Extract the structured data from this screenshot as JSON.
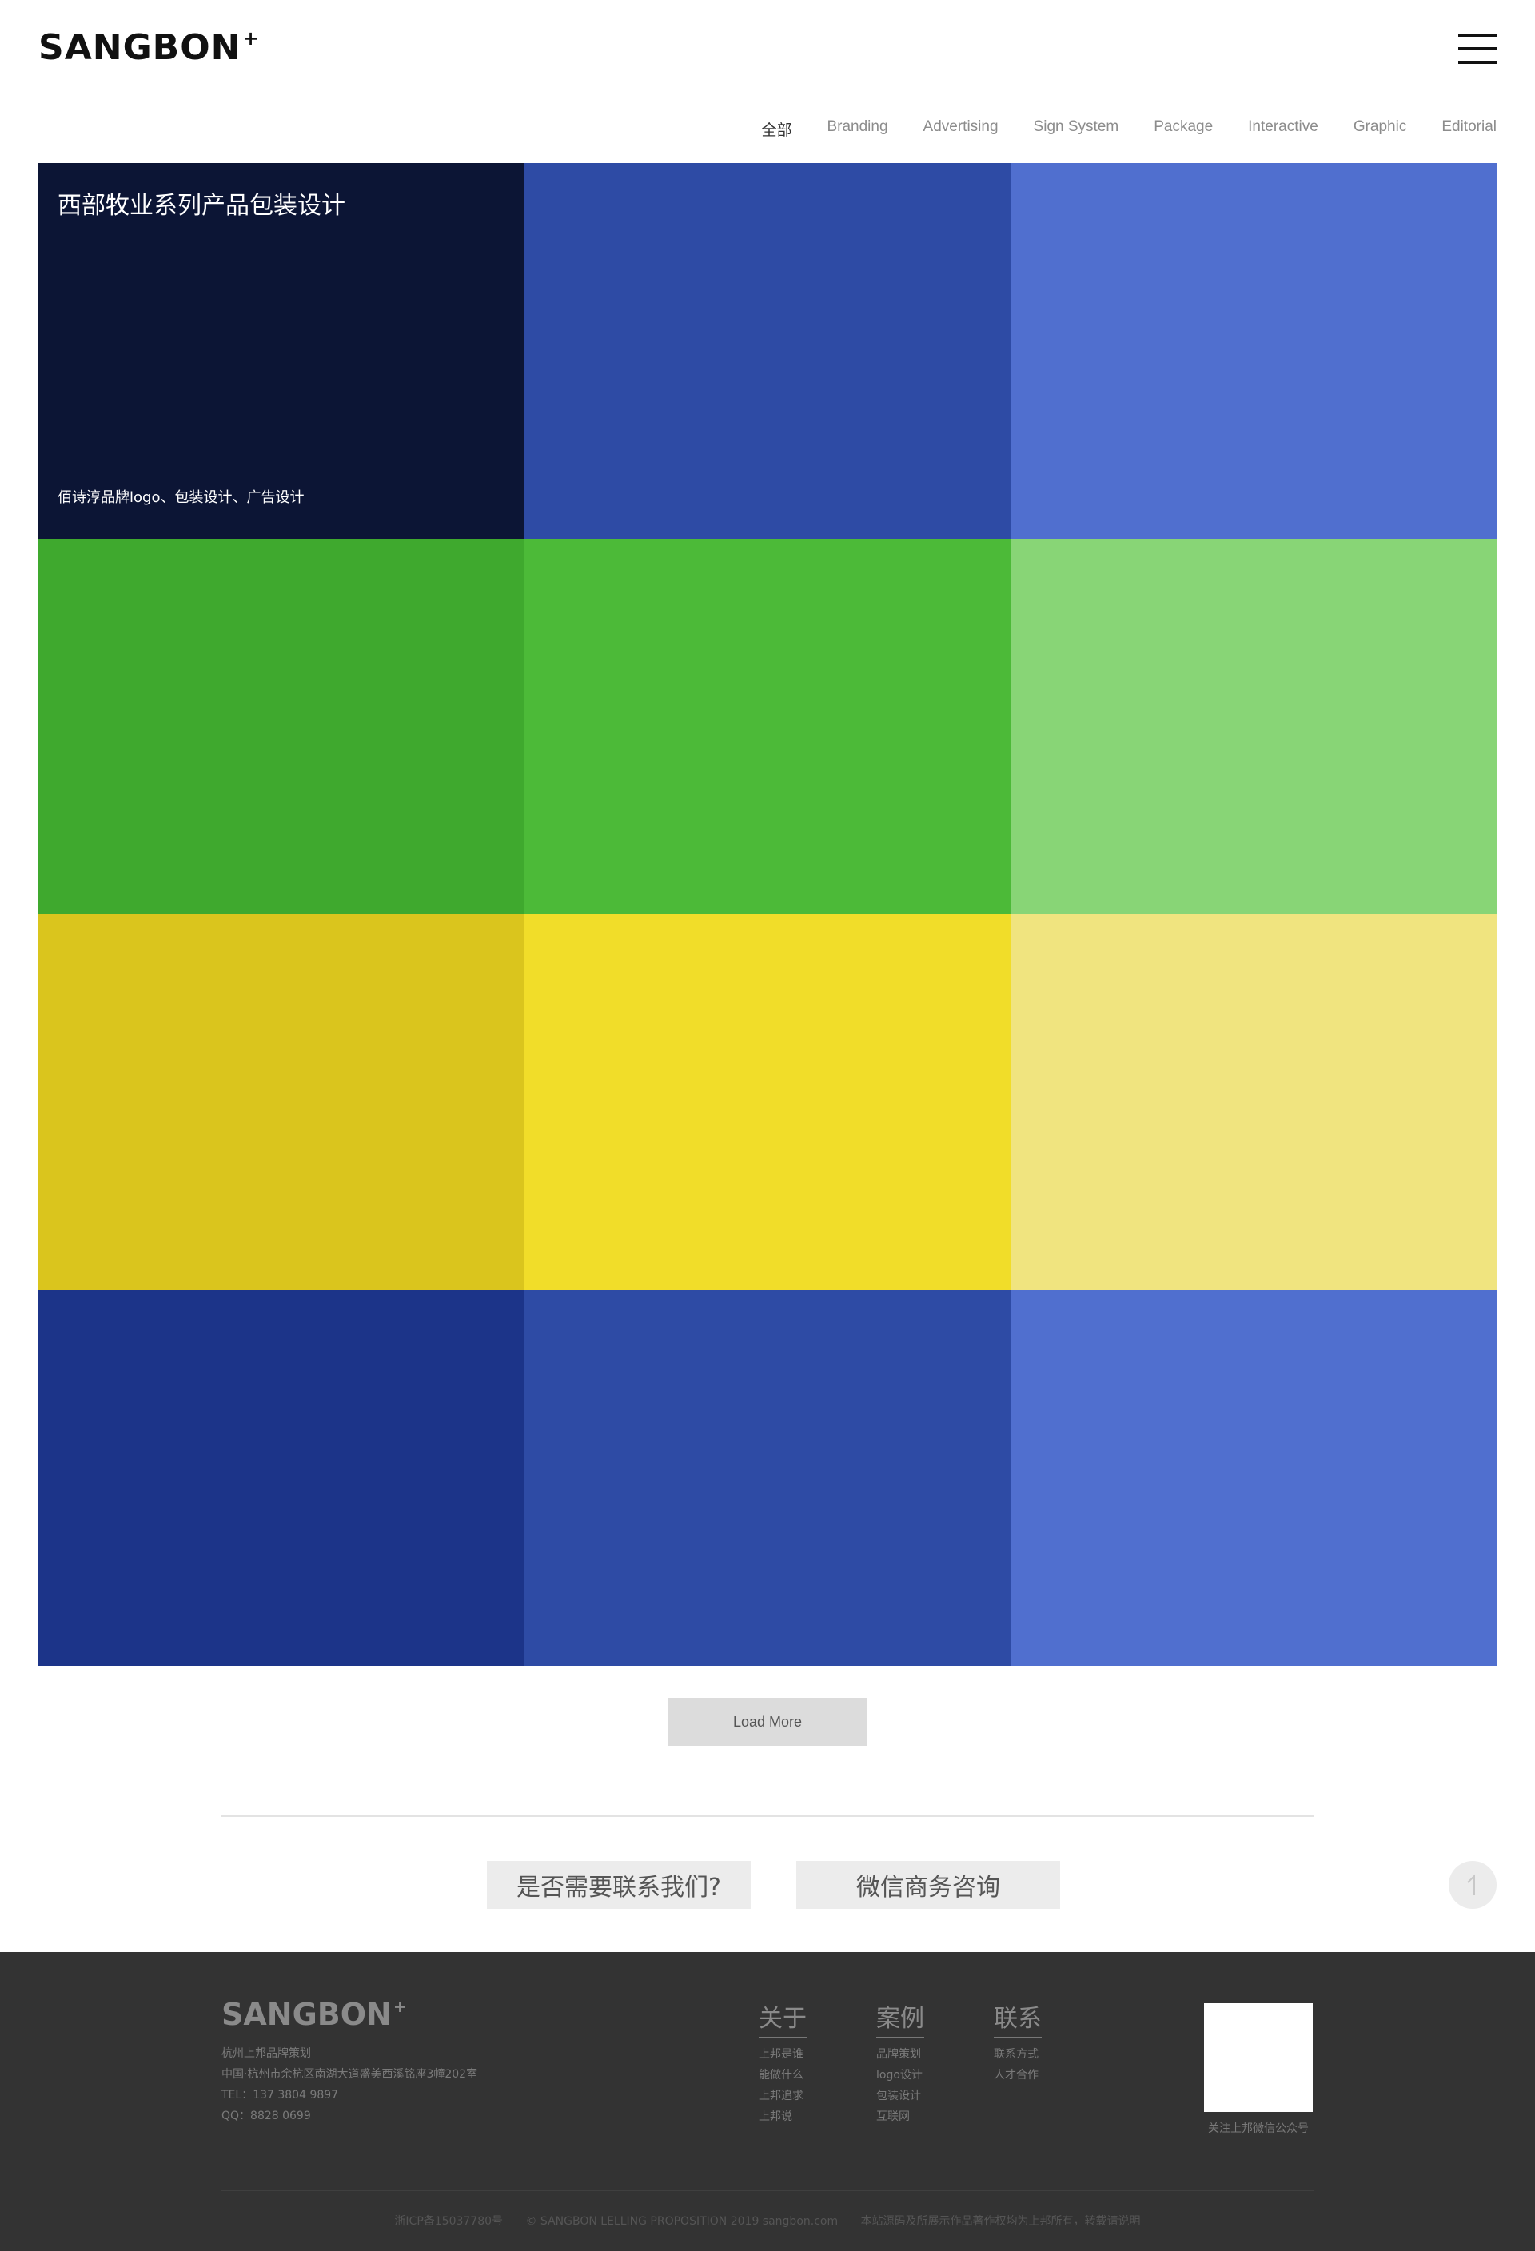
{
  "header": {
    "logo": "SANGBON",
    "logo_mark": "+",
    "menu_icon": "hamburger-menu-icon"
  },
  "filters": [
    {
      "label": "全部",
      "active": true
    },
    {
      "label": "Branding",
      "active": false
    },
    {
      "label": "Advertising",
      "active": false
    },
    {
      "label": "Sign System",
      "active": false
    },
    {
      "label": "Package",
      "active": false
    },
    {
      "label": "Interactive",
      "active": false
    },
    {
      "label": "Graphic",
      "active": false
    },
    {
      "label": "Editorial",
      "active": false
    }
  ],
  "tiles": [
    {
      "color": "#0c1535",
      "title": "西部牧业系列产品包装设计",
      "subtitle": "佰诗淳品牌logo、包装设计、广告设计"
    },
    {
      "color": "#2e4ba5",
      "title": "",
      "subtitle": ""
    },
    {
      "color": "#506fcf",
      "title": "",
      "subtitle": ""
    },
    {
      "color": "#3fa92e",
      "title": "",
      "subtitle": ""
    },
    {
      "color": "#4cba38",
      "title": "",
      "subtitle": ""
    },
    {
      "color": "#88d576",
      "title": "",
      "subtitle": ""
    },
    {
      "color": "#dac51d",
      "title": "",
      "subtitle": ""
    },
    {
      "color": "#f1dd29",
      "title": "",
      "subtitle": ""
    },
    {
      "color": "#f0e47f",
      "title": "",
      "subtitle": ""
    },
    {
      "color": "#1c3489",
      "title": "",
      "subtitle": ""
    },
    {
      "color": "#2e4ba5",
      "title": "",
      "subtitle": ""
    },
    {
      "color": "#506fcf",
      "title": "",
      "subtitle": ""
    }
  ],
  "load_more": "Load More",
  "cta": {
    "contact": "是否需要联系我们?",
    "wechat": "微信商务咨询",
    "back_top_icon": "arrow-up-icon"
  },
  "footer": {
    "logo": "SANGBON",
    "logo_mark": "+",
    "info": [
      "杭州上邦品牌策划",
      "中国·杭州市余杭区南湖大道盛美西溪铭座3幢202室",
      "TEL：137 3804 9897",
      "QQ：8828 0699"
    ],
    "columns": [
      {
        "title": "关于",
        "items": [
          "上邦是谁",
          "能做什么",
          "上邦追求",
          "上邦说"
        ]
      },
      {
        "title": "案例",
        "items": [
          "品牌策划",
          "logo设计",
          "包装设计",
          "互联网"
        ]
      },
      {
        "title": "联系",
        "items": [
          "联系方式",
          "人才合作"
        ]
      }
    ],
    "qr_caption": "关注上邦微信公众号",
    "bottom": [
      "浙ICP备15037780号",
      "© SANGBON LELLING PROPOSITION 2019 sangbon.com",
      "本站源码及所展示作品著作权均为上邦所有，转载请说明"
    ]
  }
}
